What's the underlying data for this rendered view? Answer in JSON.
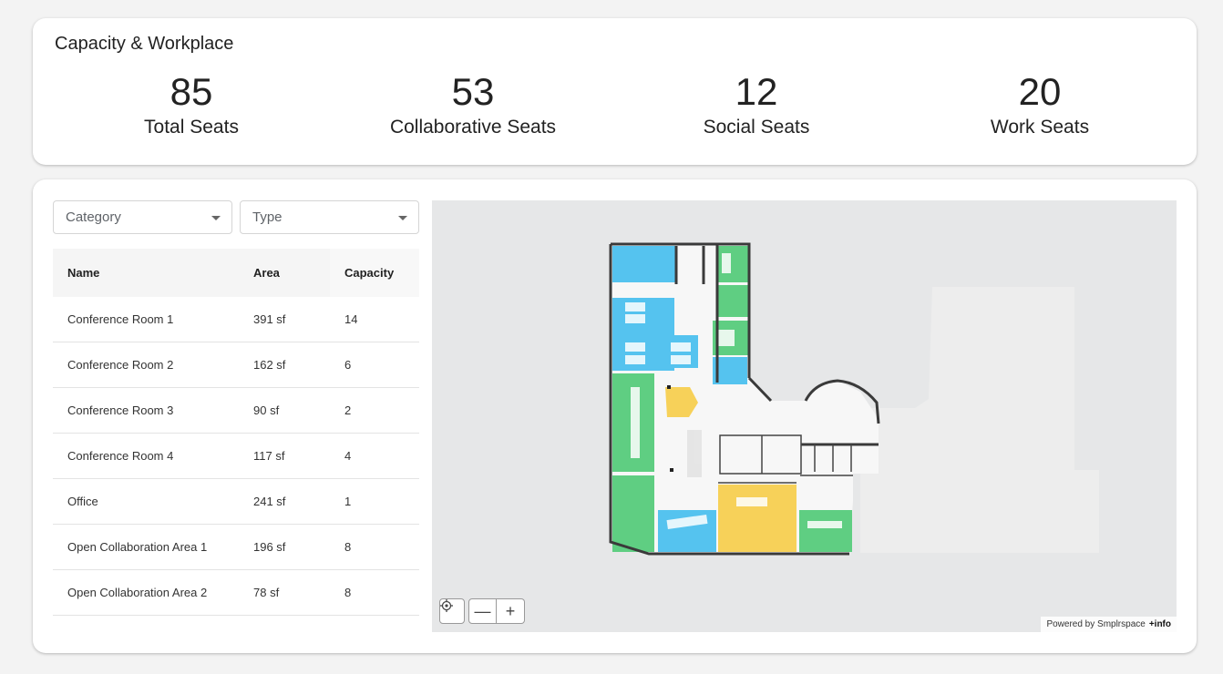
{
  "header": {
    "title": "Capacity & Workplace"
  },
  "stats": [
    {
      "value": "85",
      "label": "Total Seats"
    },
    {
      "value": "53",
      "label": "Collaborative Seats"
    },
    {
      "value": "12",
      "label": "Social Seats"
    },
    {
      "value": "20",
      "label": "Work Seats"
    }
  ],
  "filters": {
    "category_placeholder": "Category",
    "type_placeholder": "Type"
  },
  "table": {
    "columns": [
      "Name",
      "Area",
      "Capacity"
    ],
    "rows": [
      [
        "Conference Room 1",
        "391 sf",
        "14"
      ],
      [
        "Conference Room 2",
        "162 sf",
        "6"
      ],
      [
        "Conference Room 3",
        "90 sf",
        "2"
      ],
      [
        "Conference Room 4",
        "117 sf",
        "4"
      ],
      [
        "Office",
        "241 sf",
        "1"
      ],
      [
        "Open Collaboration Area 1",
        "196 sf",
        "8"
      ],
      [
        "Open Collaboration Area 2",
        "78 sf",
        "8"
      ]
    ]
  },
  "map": {
    "controls": {
      "locate_icon": "crosshair-icon",
      "zoom_out": "—",
      "zoom_in": "+"
    },
    "attribution_text": "Powered by Smplrspace",
    "attribution_link": "+info",
    "colors": {
      "collaborative": "#5fce82",
      "work": "#55c3ef",
      "social": "#f7d159",
      "floor": "#f7f7f7",
      "wall": "#3a3a3a"
    }
  }
}
